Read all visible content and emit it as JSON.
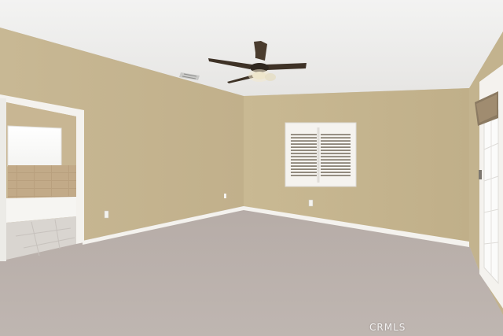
{
  "watermark": {
    "text": "CRMLS"
  },
  "colors": {
    "wall": "#c4b48e",
    "ceiling": "#eeeeec",
    "carpet": "#b9b0ab",
    "trim": "#f4f2ee"
  }
}
